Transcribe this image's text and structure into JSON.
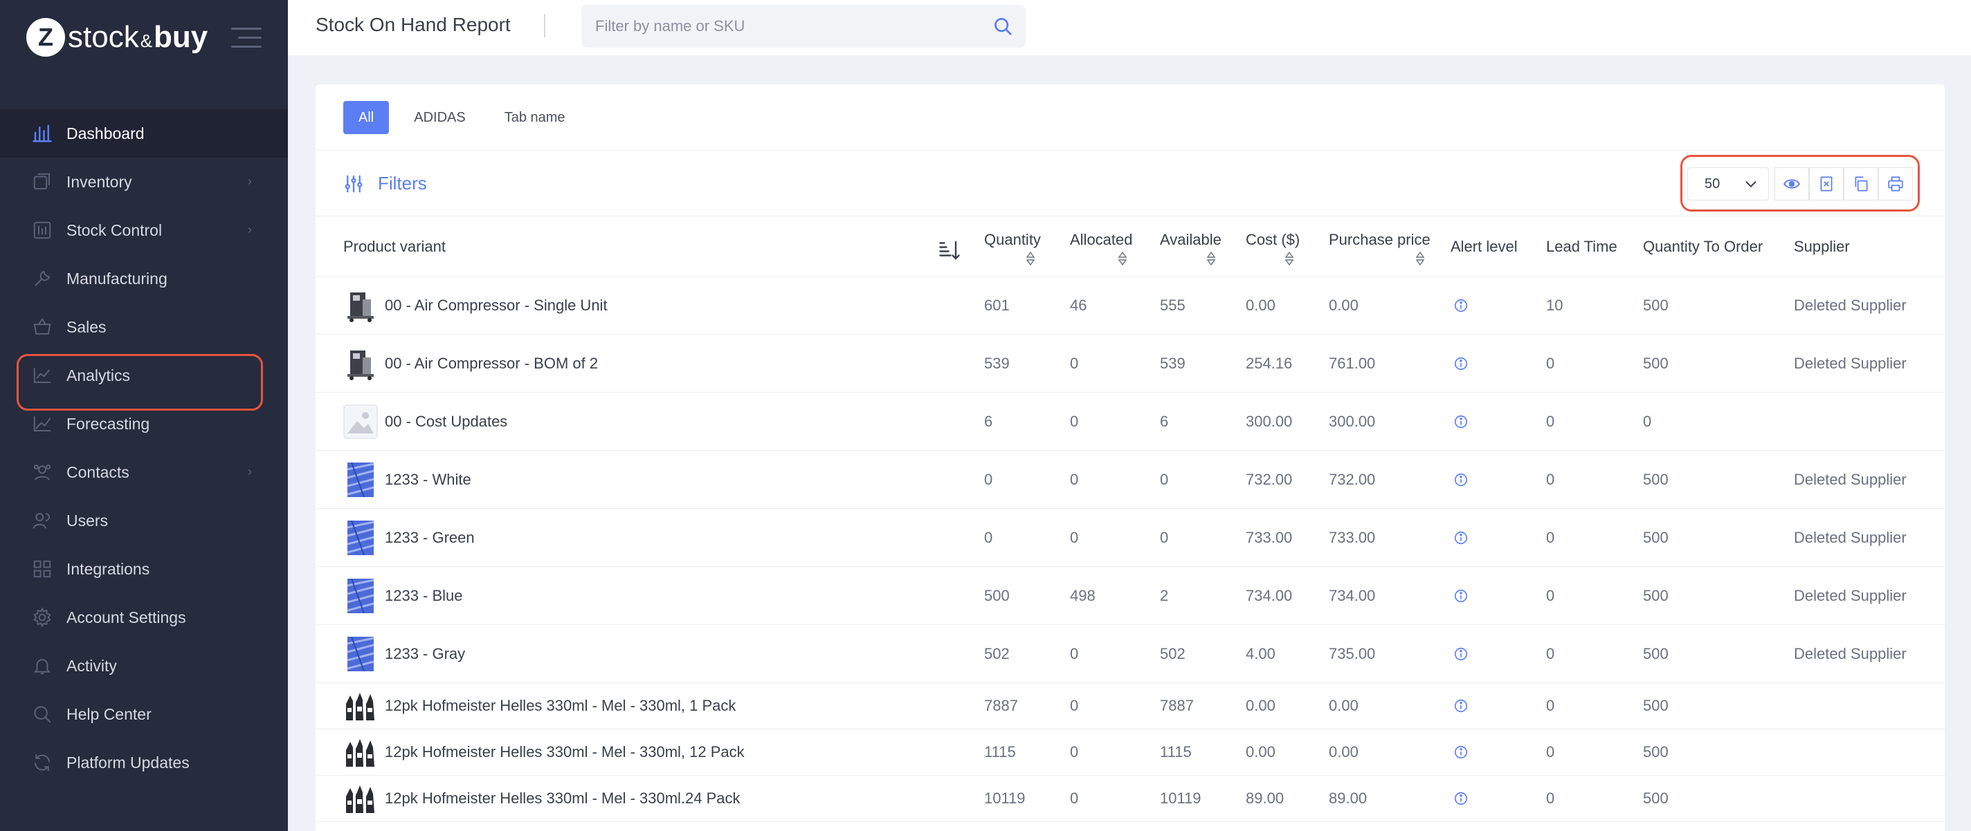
{
  "brand": {
    "logo_letter": "Z",
    "name_part1": "stock",
    "name_amp": "&",
    "name_part2": "buy"
  },
  "sidebar": {
    "items": [
      {
        "label": "Dashboard",
        "icon": "dashboard-icon",
        "has_chevron": false,
        "active": true
      },
      {
        "label": "Inventory",
        "icon": "inventory-icon",
        "has_chevron": true
      },
      {
        "label": "Stock Control",
        "icon": "stock-control-icon",
        "has_chevron": true
      },
      {
        "label": "Manufacturing",
        "icon": "manufacturing-icon",
        "has_chevron": false
      },
      {
        "label": "Sales",
        "icon": "sales-basket-icon",
        "has_chevron": false
      },
      {
        "label": "Analytics",
        "icon": "analytics-icon",
        "has_chevron": false
      },
      {
        "label": "Forecasting",
        "icon": "forecasting-icon",
        "has_chevron": false
      },
      {
        "label": "Contacts",
        "icon": "contacts-icon",
        "has_chevron": true
      },
      {
        "label": "Users",
        "icon": "users-icon",
        "has_chevron": false
      },
      {
        "label": "Integrations",
        "icon": "integrations-icon",
        "has_chevron": false
      },
      {
        "label": "Account Settings",
        "icon": "gear-icon",
        "has_chevron": false
      },
      {
        "label": "Activity",
        "icon": "bell-icon",
        "has_chevron": false
      },
      {
        "label": "Help Center",
        "icon": "help-search-icon",
        "has_chevron": false
      },
      {
        "label": "Platform Updates",
        "icon": "refresh-icon",
        "has_chevron": false
      }
    ]
  },
  "header": {
    "title": "Stock On Hand Report",
    "search_placeholder": "Filter by name or SKU"
  },
  "tabs": [
    {
      "label": "All",
      "active": true
    },
    {
      "label": "ADIDAS"
    },
    {
      "label": "Tab name"
    }
  ],
  "filters": {
    "label": "Filters"
  },
  "toolbar": {
    "per_page": "50"
  },
  "table": {
    "columns": {
      "product_variant": "Product variant",
      "quantity": "Quantity",
      "allocated": "Allocated",
      "available": "Available",
      "cost": "Cost ($)",
      "purchase_price": "Purchase price",
      "alert_level": "Alert level",
      "lead_time": "Lead Time",
      "quantity_to_order": "Quantity To Order",
      "supplier": "Supplier"
    },
    "rows": [
      {
        "name": "00 - Air Compressor - Single Unit",
        "thumb": "compressor",
        "quantity": "601",
        "allocated": "46",
        "available": "555",
        "cost": "0.00",
        "purchase_price": "0.00",
        "lead_time": "10",
        "quantity_to_order": "500",
        "supplier": "Deleted Supplier"
      },
      {
        "name": "00 - Air Compressor - BOM of 2",
        "thumb": "compressor",
        "quantity": "539",
        "allocated": "0",
        "available": "539",
        "cost": "254.16",
        "purchase_price": "761.00",
        "lead_time": "0",
        "quantity_to_order": "500",
        "supplier": "Deleted Supplier"
      },
      {
        "name": "00 - Cost Updates",
        "thumb": "placeholder",
        "quantity": "6",
        "allocated": "0",
        "available": "6",
        "cost": "300.00",
        "purchase_price": "300.00",
        "lead_time": "0",
        "quantity_to_order": "0",
        "supplier": ""
      },
      {
        "name": "1233 - White",
        "thumb": "fabric",
        "quantity": "0",
        "allocated": "0",
        "available": "0",
        "cost": "732.00",
        "purchase_price": "732.00",
        "lead_time": "0",
        "quantity_to_order": "500",
        "supplier": "Deleted Supplier"
      },
      {
        "name": "1233 - Green",
        "thumb": "fabric",
        "quantity": "0",
        "allocated": "0",
        "available": "0",
        "cost": "733.00",
        "purchase_price": "733.00",
        "lead_time": "0",
        "quantity_to_order": "500",
        "supplier": "Deleted Supplier"
      },
      {
        "name": "1233 - Blue",
        "thumb": "fabric",
        "quantity": "500",
        "allocated": "498",
        "available": "2",
        "cost": "734.00",
        "purchase_price": "734.00",
        "lead_time": "0",
        "quantity_to_order": "500",
        "supplier": "Deleted Supplier"
      },
      {
        "name": "1233 - Gray",
        "thumb": "fabric",
        "quantity": "502",
        "allocated": "0",
        "available": "502",
        "cost": "4.00",
        "purchase_price": "735.00",
        "lead_time": "0",
        "quantity_to_order": "500",
        "supplier": "Deleted Supplier"
      },
      {
        "name": "12pk Hofmeister Helles 330ml - Mel - 330ml, 1 Pack",
        "thumb": "bottles",
        "quantity": "7887",
        "allocated": "0",
        "available": "7887",
        "cost": "0.00",
        "purchase_price": "0.00",
        "lead_time": "0",
        "quantity_to_order": "500",
        "supplier": ""
      },
      {
        "name": "12pk Hofmeister Helles 330ml - Mel - 330ml, 12 Pack",
        "thumb": "bottles",
        "quantity": "1115",
        "allocated": "0",
        "available": "1115",
        "cost": "0.00",
        "purchase_price": "0.00",
        "lead_time": "0",
        "quantity_to_order": "500",
        "supplier": ""
      },
      {
        "name": "12pk Hofmeister Helles 330ml - Mel - 330ml.24 Pack",
        "thumb": "bottles",
        "quantity": "10119",
        "allocated": "0",
        "available": "10119",
        "cost": "89.00",
        "purchase_price": "89.00",
        "lead_time": "0",
        "quantity_to_order": "500",
        "supplier": ""
      }
    ]
  },
  "colors": {
    "accent": "#5b7ff2",
    "sidebar_bg": "#262b3d",
    "highlight": "#e8553e"
  }
}
